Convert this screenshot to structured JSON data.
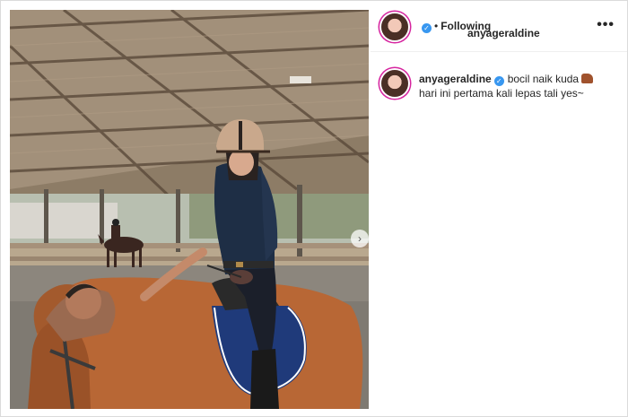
{
  "post": {
    "username": "anyageraldine",
    "verified_icon": "verified-badge-icon",
    "separator": "•",
    "follow_status": "Following",
    "more_label": "•••",
    "caption_line1": "bocil naik kuda",
    "caption_emoji": "horse-emoji-icon",
    "caption_line2": "hari ini pertama kali lepas tali yes~",
    "next_icon": "chevron-right-icon",
    "next_glyph": "›"
  },
  "colors": {
    "verified": "#3897f0",
    "story_ring": "#d6249f",
    "text": "#262626",
    "divider": "#efefef"
  }
}
